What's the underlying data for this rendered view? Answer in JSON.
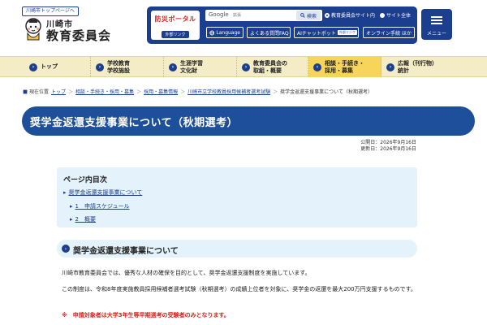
{
  "header": {
    "top_link": "川崎市トップページへ",
    "city": "川崎市",
    "title": "教育委員会",
    "bousai_label": "防災ポータル",
    "bousai_link": "外部リンク",
    "search_brand": "Google",
    "search_placeholder": "拡張",
    "search_button": "検索",
    "radio_options": [
      {
        "label": "教育委員会サイト内",
        "selected": true
      },
      {
        "label": "サイト全体",
        "selected": false
      }
    ],
    "language_label": "Language",
    "faq_label": "よくある質問FAQ",
    "chat_label": "AIチャットボット",
    "chat_ext": "外部リンク",
    "online_label": "オンライン手続 ほか",
    "menu_label": "メニュー"
  },
  "nav": {
    "items": [
      {
        "label": "トップ"
      },
      {
        "label": "学校教育\n学校施設"
      },
      {
        "label": "生涯学習\n文化財"
      },
      {
        "label": "教育委員会の\n取組・概要"
      },
      {
        "label": "相談・手続き・\n採用・募集",
        "active": true
      },
      {
        "label": "広報（刊行物）\n統計"
      }
    ]
  },
  "breadcrumb": {
    "here_label": "現在位置",
    "links": [
      "トップ",
      "相談・手続き・採用・募集",
      "採用・募集情報",
      "川崎市立学校教員採用候補者選考試験"
    ],
    "current": "奨学金返還支援事業について（秋期選考）"
  },
  "page": {
    "title": "奨学金返還支援事業について（秋期選考）",
    "published": "公開日：2026年9月16日",
    "updated": "更新日：2026年9月16日"
  },
  "toc": {
    "title": "ページ内目次",
    "items": [
      "奨学金返還支援事業について",
      "1　申請スケジュール",
      "2　概要"
    ]
  },
  "section": {
    "title": "奨学金返還支援事業について",
    "para1": "川崎市教育委員会では、優秀な人材の確保を目的として、奨学金返還支援制度を実施しています。",
    "para2": "この制度は、令和8年度実施教員採用候補者選考試験（秋期選考）の成績上位者を対象に、奨学金の返還を最大200万円支援するものです。",
    "note": "※　申請対象者は大学3年生等早期選考の受験者のみとなります。"
  },
  "colors": {
    "brand_blue": "#1b3e8f",
    "title_blue": "#1d4f9a",
    "nav_bg": "#f3ecc4",
    "nav_active": "#f6d55a",
    "toc_bg": "#e4f2fb",
    "alert_red": "#d6231e"
  }
}
